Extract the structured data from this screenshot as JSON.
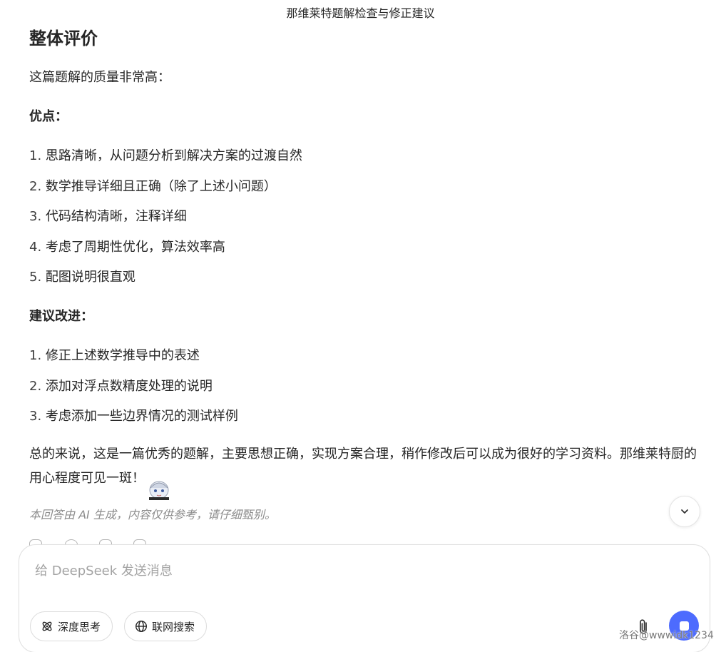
{
  "window": {
    "title": "那维莱特题解检查与修正建议"
  },
  "message": {
    "section_heading": "整体评价",
    "intro": "这篇题解的质量非常高：",
    "pros_heading": "优点：",
    "pros": [
      {
        "num": "1.",
        "text": "思路清晰，从问题分析到解决方案的过渡自然"
      },
      {
        "num": "2.",
        "text": "数学推导详细且正确（除了上述小问题）"
      },
      {
        "num": "3.",
        "text": "代码结构清晰，注释详细"
      },
      {
        "num": "4.",
        "text": "考虑了周期性优化，算法效率高"
      },
      {
        "num": "5.",
        "text": "配图说明很直观"
      }
    ],
    "suggestions_heading": "建议改进：",
    "suggestions": [
      {
        "num": "1.",
        "text": "修正上述数学推导中的表述"
      },
      {
        "num": "2.",
        "text": "添加对浮点数精度处理的说明"
      },
      {
        "num": "3.",
        "text": "考虑添加一些边界情况的测试样例"
      }
    ],
    "summary": "总的来说，这是一篇优秀的题解，主要思想正确，实现方案合理，稍作修改后可以成为很好的学习资料。那维莱特厨的用心程度可见一斑！",
    "disclaimer": "本回答由 AI 生成，内容仅供参考，请仔细甄别。"
  },
  "composer": {
    "placeholder": "给 DeepSeek 发送消息",
    "deep_think_label": "深度思考",
    "web_search_label": "联网搜索",
    "accent_color": "#4d6bfe"
  },
  "watermark": "洛谷@wwwidk1234",
  "icons": {
    "scroll": "chevron-down-icon",
    "deep_think": "atom-icon",
    "web_search": "globe-icon",
    "attach": "paperclip-icon",
    "send": "stop-icon"
  }
}
